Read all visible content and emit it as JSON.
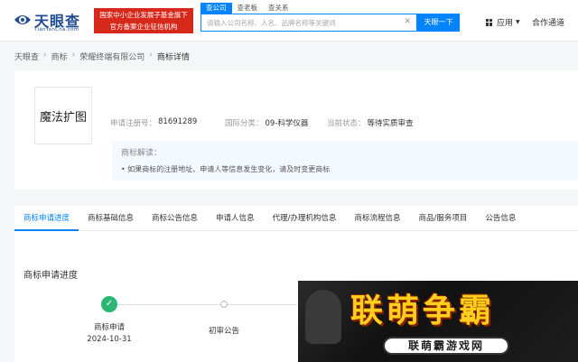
{
  "header": {
    "logo_text": "天眼查",
    "logo_sub": "TianYanCha.com",
    "banner_line1": "国家中小企业发展子基金旗下",
    "banner_line2": "官方备案企业征信机构",
    "search_tabs": [
      "查公司",
      "查老板",
      "查关系"
    ],
    "search_placeholder": "请输入公司名称、人名、品牌名称等关键词",
    "search_button": "天眼一下",
    "apps_label": "应用",
    "cooperation_label": "合作通道"
  },
  "breadcrumb": [
    "天眼查",
    "商标",
    "荣耀终端有限公司",
    "商标详情"
  ],
  "trademark": {
    "name": "魔法扩图",
    "reg_label": "申请注册号：",
    "reg_value": "81691289",
    "class_label": "国际分类：",
    "class_value": "09-科学仪器",
    "status_label": "当前状态：",
    "status_value": "等待实质审查",
    "explain_title": "商标解读：",
    "explain_item": "• 如果商标的注册地址、申请人等信息发生变化，请及时变更商标"
  },
  "tabs": [
    "商标申请进度",
    "商标基础信息",
    "商标公告信息",
    "申请人信息",
    "代理/办理机构信息",
    "商标流程信息",
    "商品/服务项目",
    "公告信息"
  ],
  "progress": {
    "title": "商标申请进度",
    "steps": [
      {
        "label": "商标申请",
        "date": "2024-10-31",
        "done": true
      },
      {
        "label": "初审公告",
        "date": "",
        "done": false
      }
    ]
  },
  "ad": {
    "title": "联萌争霸",
    "subtitle": "联萌霸游戏网"
  },
  "colors": {
    "brand_blue": "#0084ff",
    "done_green": "#2bb673",
    "banner_red": "#d7281c",
    "ad_yellow": "#ffcf1b"
  }
}
